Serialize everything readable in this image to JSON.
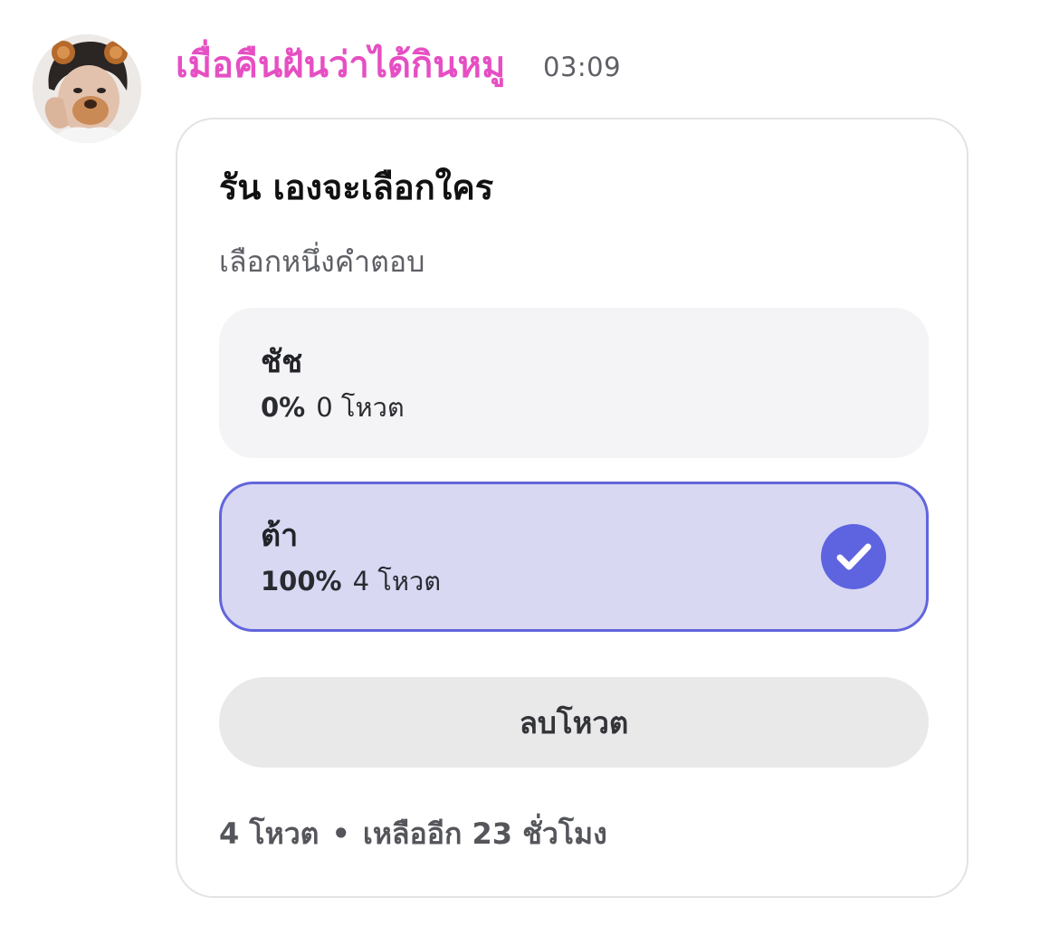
{
  "message": {
    "author": "เมื่อคืนฝันว่าได้กินหมู",
    "time": "03:09",
    "author_color": "#e64fc3"
  },
  "poll": {
    "question": "รัน เองจะเลือกใคร",
    "hint": "เลือกหนึ่งคำตอบ",
    "options": [
      {
        "label": "ชัช",
        "percent": "0%",
        "votes": "0 โหวต",
        "selected": false
      },
      {
        "label": "ต้า",
        "percent": "100%",
        "votes": "4 โหวต",
        "selected": true
      }
    ],
    "remove_vote_label": "ลบโหวต",
    "footer": {
      "total_votes": "4 โหวต",
      "separator": "•",
      "time_left": "เหลืออีก 23 ชั่วโมง"
    },
    "accent_color": "#5e63e0",
    "selected_bg": "#d8d8f3"
  },
  "icons": {
    "avatar": "user-avatar-photo",
    "selected": "check-circle-icon"
  }
}
